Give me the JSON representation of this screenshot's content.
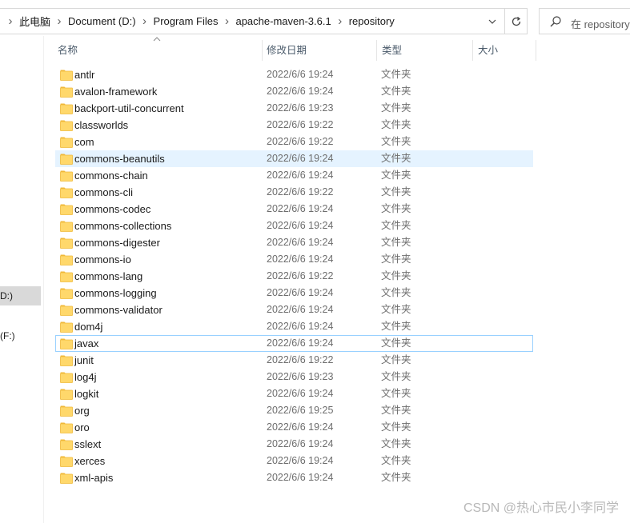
{
  "breadcrumb": [
    "此电脑",
    "Document (D:)",
    "Program Files",
    "apache-maven-3.6.1",
    "repository"
  ],
  "search": {
    "placeholder": "在 repository 中搜索",
    "visible_text": "在 repository"
  },
  "nav": {
    "drive_d_label": "D:)",
    "drive_f_label": "(F:)"
  },
  "columns": {
    "name": "名称",
    "date": "修改日期",
    "type": "类型",
    "size": "大小"
  },
  "files": [
    {
      "name": "antlr",
      "date": "2022/6/6 19:24",
      "type": "文件夹",
      "size": ""
    },
    {
      "name": "avalon-framework",
      "date": "2022/6/6 19:24",
      "type": "文件夹",
      "size": ""
    },
    {
      "name": "backport-util-concurrent",
      "date": "2022/6/6 19:23",
      "type": "文件夹",
      "size": ""
    },
    {
      "name": "classworlds",
      "date": "2022/6/6 19:22",
      "type": "文件夹",
      "size": ""
    },
    {
      "name": "com",
      "date": "2022/6/6 19:22",
      "type": "文件夹",
      "size": ""
    },
    {
      "name": "commons-beanutils",
      "date": "2022/6/6 19:24",
      "type": "文件夹",
      "size": "",
      "state": "hover"
    },
    {
      "name": "commons-chain",
      "date": "2022/6/6 19:24",
      "type": "文件夹",
      "size": ""
    },
    {
      "name": "commons-cli",
      "date": "2022/6/6 19:22",
      "type": "文件夹",
      "size": ""
    },
    {
      "name": "commons-codec",
      "date": "2022/6/6 19:24",
      "type": "文件夹",
      "size": ""
    },
    {
      "name": "commons-collections",
      "date": "2022/6/6 19:24",
      "type": "文件夹",
      "size": ""
    },
    {
      "name": "commons-digester",
      "date": "2022/6/6 19:24",
      "type": "文件夹",
      "size": ""
    },
    {
      "name": "commons-io",
      "date": "2022/6/6 19:24",
      "type": "文件夹",
      "size": ""
    },
    {
      "name": "commons-lang",
      "date": "2022/6/6 19:22",
      "type": "文件夹",
      "size": ""
    },
    {
      "name": "commons-logging",
      "date": "2022/6/6 19:24",
      "type": "文件夹",
      "size": ""
    },
    {
      "name": "commons-validator",
      "date": "2022/6/6 19:24",
      "type": "文件夹",
      "size": ""
    },
    {
      "name": "dom4j",
      "date": "2022/6/6 19:24",
      "type": "文件夹",
      "size": ""
    },
    {
      "name": "javax",
      "date": "2022/6/6 19:24",
      "type": "文件夹",
      "size": "",
      "state": "focused"
    },
    {
      "name": "junit",
      "date": "2022/6/6 19:22",
      "type": "文件夹",
      "size": ""
    },
    {
      "name": "log4j",
      "date": "2022/6/6 19:23",
      "type": "文件夹",
      "size": ""
    },
    {
      "name": "logkit",
      "date": "2022/6/6 19:24",
      "type": "文件夹",
      "size": ""
    },
    {
      "name": "org",
      "date": "2022/6/6 19:25",
      "type": "文件夹",
      "size": ""
    },
    {
      "name": "oro",
      "date": "2022/6/6 19:24",
      "type": "文件夹",
      "size": ""
    },
    {
      "name": "sslext",
      "date": "2022/6/6 19:24",
      "type": "文件夹",
      "size": ""
    },
    {
      "name": "xerces",
      "date": "2022/6/6 19:24",
      "type": "文件夹",
      "size": ""
    },
    {
      "name": "xml-apis",
      "date": "2022/6/6 19:24",
      "type": "文件夹",
      "size": ""
    }
  ],
  "icons": {
    "folder": "folder-icon",
    "search": "search-icon",
    "dropdown": "chevron-down-icon",
    "refresh": "refresh-icon",
    "sort": "sort-ascending-icon"
  },
  "colors": {
    "hover_row": "#e5f3ff",
    "focus_border": "#99d1ff",
    "folder_fill": "#ffd86b",
    "folder_tab": "#f0b93a"
  },
  "watermark": "CSDN @热心市民小李同学"
}
